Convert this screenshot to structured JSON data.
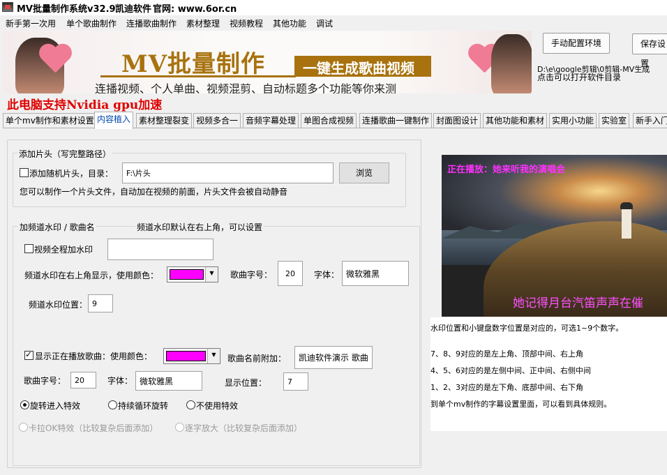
{
  "window": {
    "title": "MV批量制作系统v32.9",
    "vendor": "凯迪软件",
    "website": "官网: www.6or.cn"
  },
  "menu": [
    "新手第一次用",
    "单个歌曲制作",
    "连播歌曲制作",
    "素材整理",
    "视频教程",
    "其他功能",
    "调试"
  ],
  "banner": {
    "title": "MV批量制作",
    "subtitle": "一键生成歌曲视频",
    "description": "连播视频、个人单曲、视频混剪、自动标题多个功能等你来测"
  },
  "header_buttons": {
    "manual_env": "手动配置环境",
    "save": "保存设置"
  },
  "path_info": {
    "path": "D:\\e\\google剪辑\\0剪辑-MV生成",
    "hint": "点击可以打开软件目录"
  },
  "gpu_notice": "此电脑支持Nvidia gpu加速",
  "tabs": [
    "单个mv制作和素材设置",
    "内容植入",
    "素材整理裂变",
    "视频多合一",
    "音频字幕处理",
    "单图合成视频",
    "连播歌曲一键制作",
    "封面图设计",
    "其他功能和素材",
    "实用小功能",
    "实验室",
    "新手入门"
  ],
  "active_tab": "内容植入",
  "intro": {
    "group_title": "添加片头（写完整路径）",
    "random_label": "添加随机片头，目录：",
    "random_checked": false,
    "dir_value": "F:\\片头",
    "browse": "浏览",
    "hint": "您可以制作一个片头文件，自动加在视频的前面，片头文件会被自动静音"
  },
  "watermark": {
    "group_title": "加频道水印  /  歌曲名",
    "group_note": "频道水印默认在右上角，可以设置",
    "full_label": "视频全程加水印",
    "full_checked": false,
    "full_value": "",
    "color_label": "频道水印在右上角显示，使用颜色：",
    "color": "#ff00ff",
    "song_size_label": "歌曲字号：",
    "song_size": "20",
    "font_label": "字体：",
    "font": "微软雅黑",
    "pos_label": "频道水印位置：",
    "pos": "9"
  },
  "now_playing": {
    "label": "显示正在播放歌曲：使用颜色：",
    "checked": true,
    "color": "#ff00ff",
    "prefix_label": "歌曲名前附加：",
    "prefix": "凯迪软件演示  歌曲",
    "size_label": "歌曲字号：",
    "size": "20",
    "font_label": "字体：",
    "font": "微软雅黑",
    "pos_label": "显示位置：",
    "pos": "7",
    "effects": [
      "旋转进入特效",
      "持续循环旋转",
      "不使用特效"
    ],
    "effect_selected": 0,
    "disabled_effects": [
      "卡拉OK特效（比较复杂后面添加）",
      "逐字放大（比较复杂后面添加）"
    ]
  },
  "preview": {
    "top_text": "正在播放：她来听我的演唱会",
    "bottom_text": "她记得月台汽笛声声在催"
  },
  "info_lines": [
    "水印位置和小键盘数字位置是对应的，可选1~9个数字。",
    "7、8、9对应的是左上角、顶部中间、右上角",
    "4、5、6对应的是左侧中间、正中间、右侧中间",
    "1、2、3对应的是左下角、底部中间、右下角",
    "到单个mv制作的字幕设置里面，可以看到具体规则。"
  ],
  "colors": {
    "accent_gold": "#a8720e",
    "notice_red": "#e00000",
    "active_tab_text": "#0046b0",
    "magenta": "#ff00ff"
  }
}
